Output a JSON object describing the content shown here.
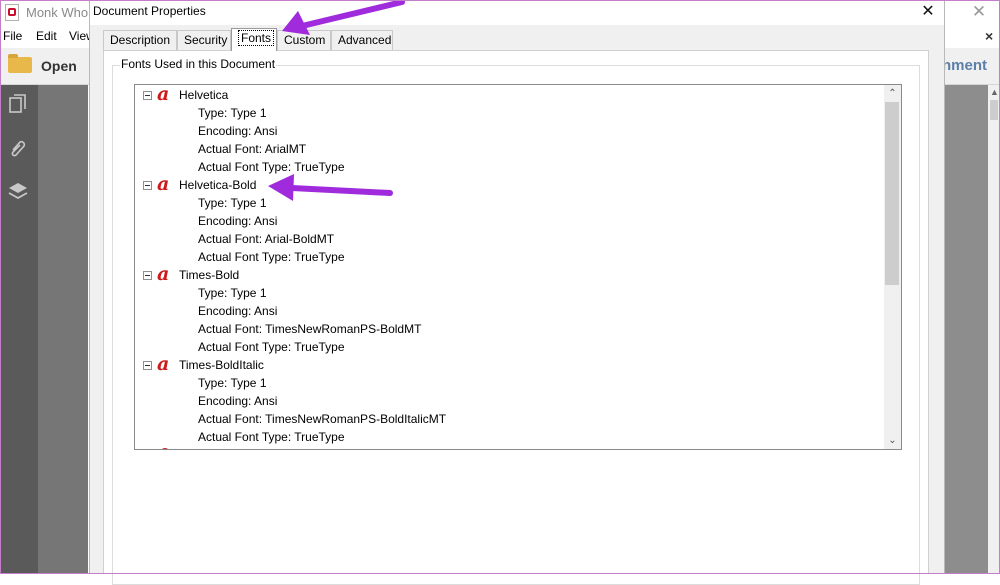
{
  "app": {
    "title": "Monk Who",
    "close_glyph": "✕",
    "menu": [
      "File",
      "Edit",
      "View"
    ],
    "menu_close_glyph": "×",
    "toolbar": {
      "open_label": "Open",
      "right_label": "nment"
    }
  },
  "dialog": {
    "title": "Document Properties",
    "close_glyph": "✕",
    "tabs": [
      {
        "label": "Description",
        "active": false
      },
      {
        "label": "Security",
        "active": false
      },
      {
        "label": "Fonts",
        "active": true
      },
      {
        "label": "Custom",
        "active": false
      },
      {
        "label": "Advanced",
        "active": false
      }
    ],
    "group_label": "Fonts Used in this Document",
    "fonts": [
      {
        "name": "Helvetica",
        "type": "Type: Type 1",
        "encoding": "Encoding: Ansi",
        "actual_font": "Actual Font: ArialMT",
        "actual_type": "Actual Font Type: TrueType"
      },
      {
        "name": "Helvetica-Bold",
        "type": "Type: Type 1",
        "encoding": "Encoding: Ansi",
        "actual_font": "Actual Font: Arial-BoldMT",
        "actual_type": "Actual Font Type: TrueType"
      },
      {
        "name": "Times-Bold",
        "type": "Type: Type 1",
        "encoding": "Encoding: Ansi",
        "actual_font": "Actual Font: TimesNewRomanPS-BoldMT",
        "actual_type": "Actual Font Type: TrueType"
      },
      {
        "name": "Times-BoldItalic",
        "type": "Type: Type 1",
        "encoding": "Encoding: Ansi",
        "actual_font": "Actual Font: TimesNewRomanPS-BoldItalicMT",
        "actual_type": "Actual Font Type: TrueType"
      }
    ],
    "font_icon_glyph": "a",
    "scroll_up_glyph": "⌃",
    "scroll_down_glyph": "⌄"
  },
  "colors": {
    "annotation_arrow": "#a02bdc",
    "font_icon": "#cc1b1b"
  }
}
